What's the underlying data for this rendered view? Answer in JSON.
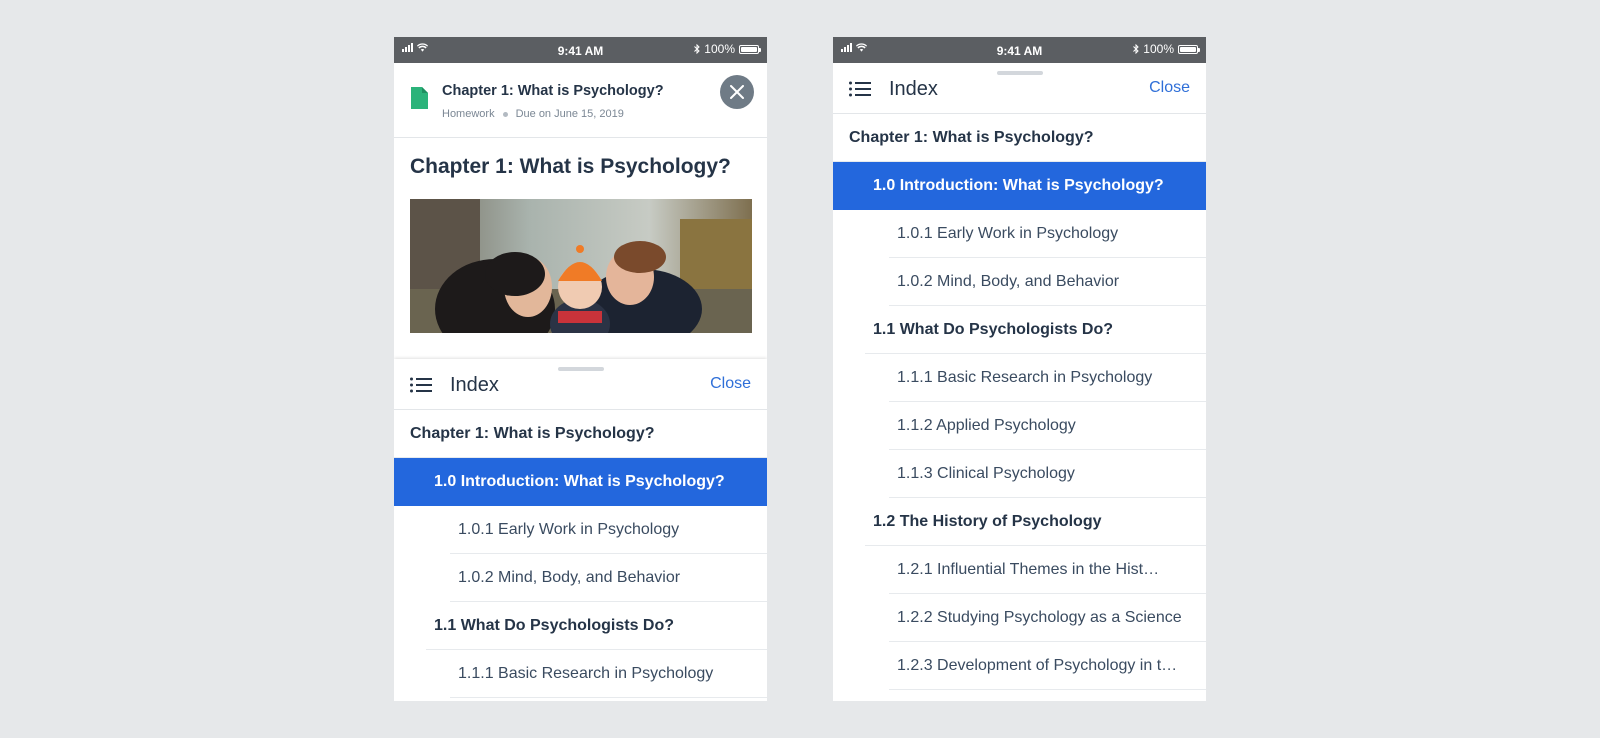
{
  "status_bar": {
    "time": "9:41 AM",
    "battery": "100%"
  },
  "assignment": {
    "title": "Chapter 1: What is Psychology?",
    "type": "Homework",
    "due": "Due on June 15, 2019",
    "icon": "document-icon",
    "icon_color": "#2bb37a"
  },
  "content": {
    "heading": "Chapter 1: What is Psychology?",
    "image": "family-photo"
  },
  "index": {
    "title": "Index",
    "close_label": "Close"
  },
  "toc_left": [
    {
      "label": "Chapter 1: What is Psychology?",
      "level": 0,
      "active": false
    },
    {
      "label": "1.0 Introduction: What is Psychology?",
      "level": 1,
      "active": true
    },
    {
      "label": "1.0.1 Early Work in Psychology",
      "level": 2,
      "active": false
    },
    {
      "label": "1.0.2 Mind, Body, and Behavior",
      "level": 2,
      "active": false
    },
    {
      "label": "1.1 What Do Psychologists Do?",
      "level": 1,
      "active": false
    },
    {
      "label": "1.1.1 Basic Research in Psychology",
      "level": 2,
      "active": false
    },
    {
      "label": "1.1.2 Applied Psychology",
      "level": 2,
      "active": false
    }
  ],
  "toc_right": [
    {
      "label": "Chapter 1: What is Psychology?",
      "level": 0,
      "active": false
    },
    {
      "label": "1.0 Introduction: What is Psychology?",
      "level": 1,
      "active": true
    },
    {
      "label": "1.0.1 Early Work in Psychology",
      "level": 2,
      "active": false
    },
    {
      "label": "1.0.2 Mind, Body, and Behavior",
      "level": 2,
      "active": false
    },
    {
      "label": "1.1 What Do Psychologists Do?",
      "level": 1,
      "active": false
    },
    {
      "label": "1.1.1 Basic Research in Psychology",
      "level": 2,
      "active": false
    },
    {
      "label": "1.1.2 Applied Psychology",
      "level": 2,
      "active": false
    },
    {
      "label": "1.1.3 Clinical Psychology",
      "level": 2,
      "active": false
    },
    {
      "label": "1.2 The History of Psychology",
      "level": 1,
      "active": false
    },
    {
      "label": "1.2.1 Influential Themes in the Hist…",
      "level": 2,
      "active": false
    },
    {
      "label": "1.2.2 Studying Psychology as a Science",
      "level": 2,
      "active": false
    },
    {
      "label": "1.2.3 Development of Psychology in t…",
      "level": 2,
      "active": false
    }
  ],
  "colors": {
    "accent": "#2367dd",
    "link": "#2f6fd8",
    "text": "#253447",
    "background": "#e6e8ea"
  }
}
